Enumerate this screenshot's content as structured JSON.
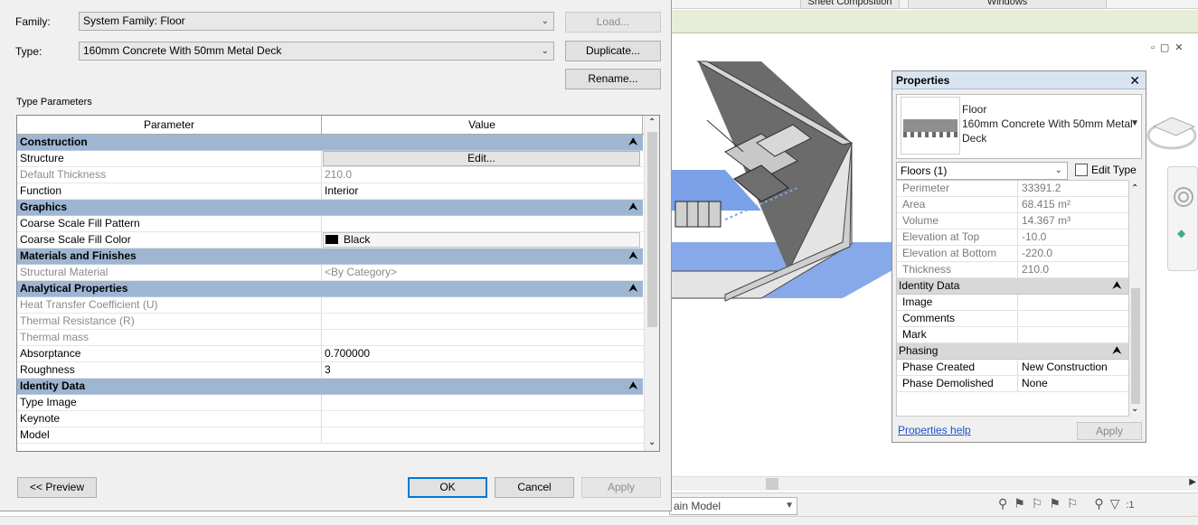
{
  "background": {
    "ribbon_tabs": [
      "Sheet Composition",
      "Windows"
    ],
    "model_combo": "ain Model",
    "status_filter_count": ":1"
  },
  "properties_palette": {
    "title": "Properties",
    "type_name_lines": [
      "Floor",
      "160mm Concrete With 50mm Metal",
      "Deck"
    ],
    "instance_filter": "Floors (1)",
    "edit_type_label": "Edit Type",
    "rows_top": [
      {
        "name": "Perimeter",
        "value": "33391.2"
      },
      {
        "name": "Area",
        "value": "68.415 m²"
      },
      {
        "name": "Volume",
        "value": "14.367 m³"
      },
      {
        "name": "Elevation at Top",
        "value": "-10.0"
      },
      {
        "name": "Elevation at Bottom",
        "value": "-220.0"
      },
      {
        "name": "Thickness",
        "value": "210.0"
      }
    ],
    "group_identity": "Identity Data",
    "identity_rows": [
      {
        "name": "Image",
        "value": ""
      },
      {
        "name": "Comments",
        "value": ""
      },
      {
        "name": "Mark",
        "value": ""
      }
    ],
    "group_phasing": "Phasing",
    "phasing_rows": [
      {
        "name": "Phase Created",
        "value": "New Construction"
      },
      {
        "name": "Phase Demolished",
        "value": "None"
      }
    ],
    "help_link": "Properties help",
    "apply_label": "Apply"
  },
  "dialog": {
    "family_label": "Family:",
    "family_value": "System Family: Floor",
    "type_label": "Type:",
    "type_value": "160mm Concrete With 50mm Metal Deck",
    "load_label": "Load...",
    "duplicate_label": "Duplicate...",
    "rename_label": "Rename...",
    "type_parameters_label": "Type Parameters",
    "col_parameter": "Parameter",
    "col_value": "Value",
    "groups": {
      "construction": "Construction",
      "graphics": "Graphics",
      "materials": "Materials and Finishes",
      "analytical": "Analytical Properties",
      "identity": "Identity Data"
    },
    "construction_rows": [
      {
        "name": "Structure",
        "value": "Edit..."
      },
      {
        "name": "Default Thickness",
        "value": "210.0"
      },
      {
        "name": "Function",
        "value": "Interior"
      }
    ],
    "graphics_rows": [
      {
        "name": "Coarse Scale Fill Pattern",
        "value": ""
      },
      {
        "name": "Coarse Scale Fill Color",
        "value": "Black"
      }
    ],
    "materials_rows": [
      {
        "name": "Structural Material",
        "value": "<By Category>"
      }
    ],
    "analytical_rows": [
      {
        "name": "Heat Transfer Coefficient (U)",
        "value": ""
      },
      {
        "name": "Thermal Resistance (R)",
        "value": ""
      },
      {
        "name": "Thermal mass",
        "value": ""
      },
      {
        "name": "Absorptance",
        "value": "0.700000"
      },
      {
        "name": "Roughness",
        "value": "3"
      }
    ],
    "identity_rows": [
      {
        "name": "Type Image",
        "value": ""
      },
      {
        "name": "Keynote",
        "value": ""
      },
      {
        "name": "Model",
        "value": ""
      }
    ],
    "preview_label": "<< Preview",
    "ok_label": "OK",
    "cancel_label": "Cancel",
    "apply_label": "Apply"
  },
  "colors": {
    "group_header": "#9eb6d2",
    "floor_blue": "#7aa0e8",
    "link_blue": "#1a52c9"
  }
}
